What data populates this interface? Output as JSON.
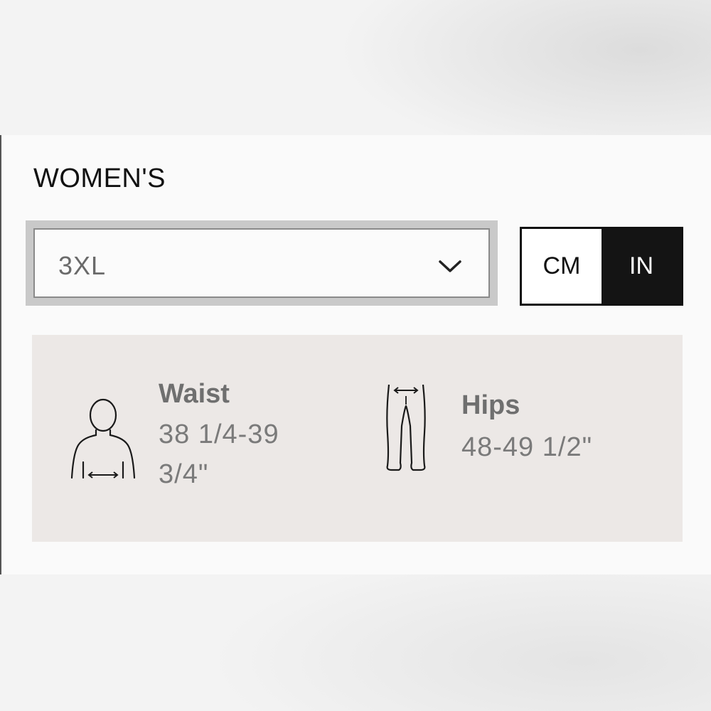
{
  "section": {
    "title": "WOMEN'S"
  },
  "size_select": {
    "value": "3XL",
    "icon": "chevron-down-icon"
  },
  "unit_toggle": {
    "options": [
      "CM",
      "IN"
    ],
    "selected": "IN"
  },
  "measurements": [
    {
      "label": "Waist",
      "value_line1": "38 1/4-39",
      "value_line2": "3/4\"",
      "icon": "torso-waist-icon"
    },
    {
      "label": "Hips",
      "value_line1": "48-49 1/2\"",
      "icon": "pants-hips-icon"
    }
  ],
  "colors": {
    "selected_unit_bg": "#141414",
    "measure_box_bg": "#ece8e6"
  }
}
